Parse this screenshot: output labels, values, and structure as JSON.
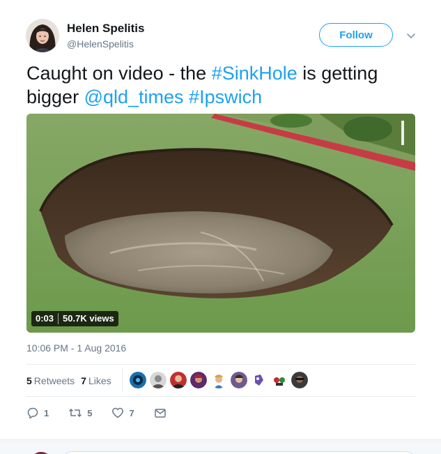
{
  "author": {
    "name": "Helen Spelitis",
    "handle": "@HelenSpelitis",
    "avatar_icon": "user-avatar"
  },
  "header": {
    "follow_label": "Follow",
    "menu_icon": "chevron-down-icon"
  },
  "tweet": {
    "text_prefix": "Caught on video - the ",
    "hashtag1": "#SinkHole",
    "text_middle": " is getting bigger ",
    "mention": "@qld_times",
    "hashtag2": "#Ipswich"
  },
  "media": {
    "type": "video",
    "duration": "0:03",
    "views": "50.7K views"
  },
  "timestamp": "10:06 PM - 1 Aug 2016",
  "stats": {
    "retweets_count": "5",
    "retweets_label": "Retweets",
    "likes_count": "7",
    "likes_label": "Likes"
  },
  "actions": {
    "reply_count": "1",
    "retweet_count": "5",
    "like_count": "7"
  },
  "colors": {
    "accent": "#1da1f2",
    "muted": "#657786",
    "text": "#14171a",
    "border": "#e6ecf0"
  }
}
